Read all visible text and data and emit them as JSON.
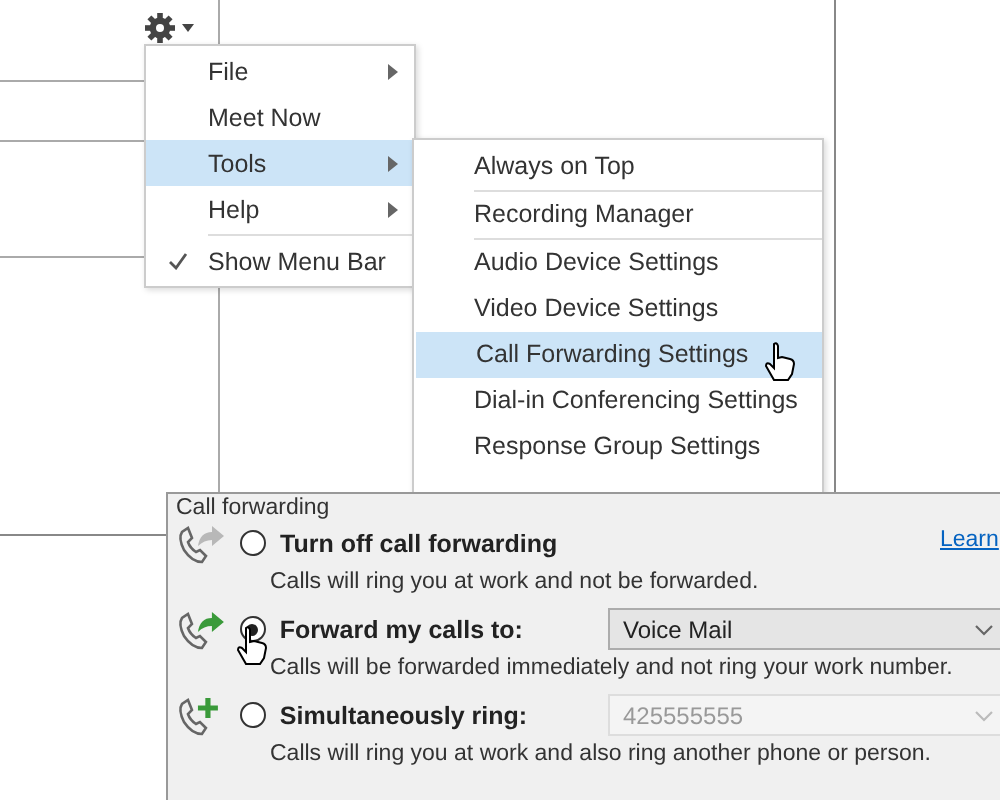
{
  "menu": {
    "items": [
      {
        "kind": "item",
        "label": "File",
        "submenu": true,
        "checked": false,
        "selected": false
      },
      {
        "kind": "item",
        "label": "Meet Now",
        "submenu": false,
        "checked": false,
        "selected": false
      },
      {
        "kind": "item",
        "label": "Tools",
        "submenu": true,
        "checked": false,
        "selected": true
      },
      {
        "kind": "item",
        "label": "Help",
        "submenu": true,
        "checked": false,
        "selected": false
      },
      {
        "kind": "separator"
      },
      {
        "kind": "item",
        "label": "Show Menu Bar",
        "submenu": false,
        "checked": true,
        "selected": false
      }
    ]
  },
  "submenu": {
    "items": [
      {
        "kind": "item",
        "label": "Always on Top",
        "selected": false
      },
      {
        "kind": "separator"
      },
      {
        "kind": "item",
        "label": "Recording Manager",
        "selected": false
      },
      {
        "kind": "separator"
      },
      {
        "kind": "item",
        "label": "Audio Device Settings",
        "selected": false
      },
      {
        "kind": "item",
        "label": "Video Device Settings",
        "selected": false
      },
      {
        "kind": "item",
        "label": "Call Forwarding Settings",
        "selected": true
      },
      {
        "kind": "item",
        "label": "Dial-in Conferencing Settings",
        "selected": false
      },
      {
        "kind": "item",
        "label": "Response Group Settings",
        "selected": false
      }
    ]
  },
  "dialog": {
    "group_title": "Call forwarding",
    "link": "Learn",
    "options": [
      {
        "kind": "turn-off",
        "label": "Turn off call forwarding",
        "selected": false,
        "description": "Calls will ring you at work and not be forwarded."
      },
      {
        "kind": "forward",
        "label": "Forward my calls to:",
        "selected": true,
        "dropdown": {
          "value": "Voice Mail",
          "disabled": false
        },
        "description": "Calls will be forwarded immediately and not ring your work number."
      },
      {
        "kind": "simultaneous",
        "label": "Simultaneously ring:",
        "selected": false,
        "dropdown": {
          "value": "425555555",
          "disabled": true
        },
        "description": "Calls will ring you at work and also ring another phone or person."
      }
    ]
  }
}
